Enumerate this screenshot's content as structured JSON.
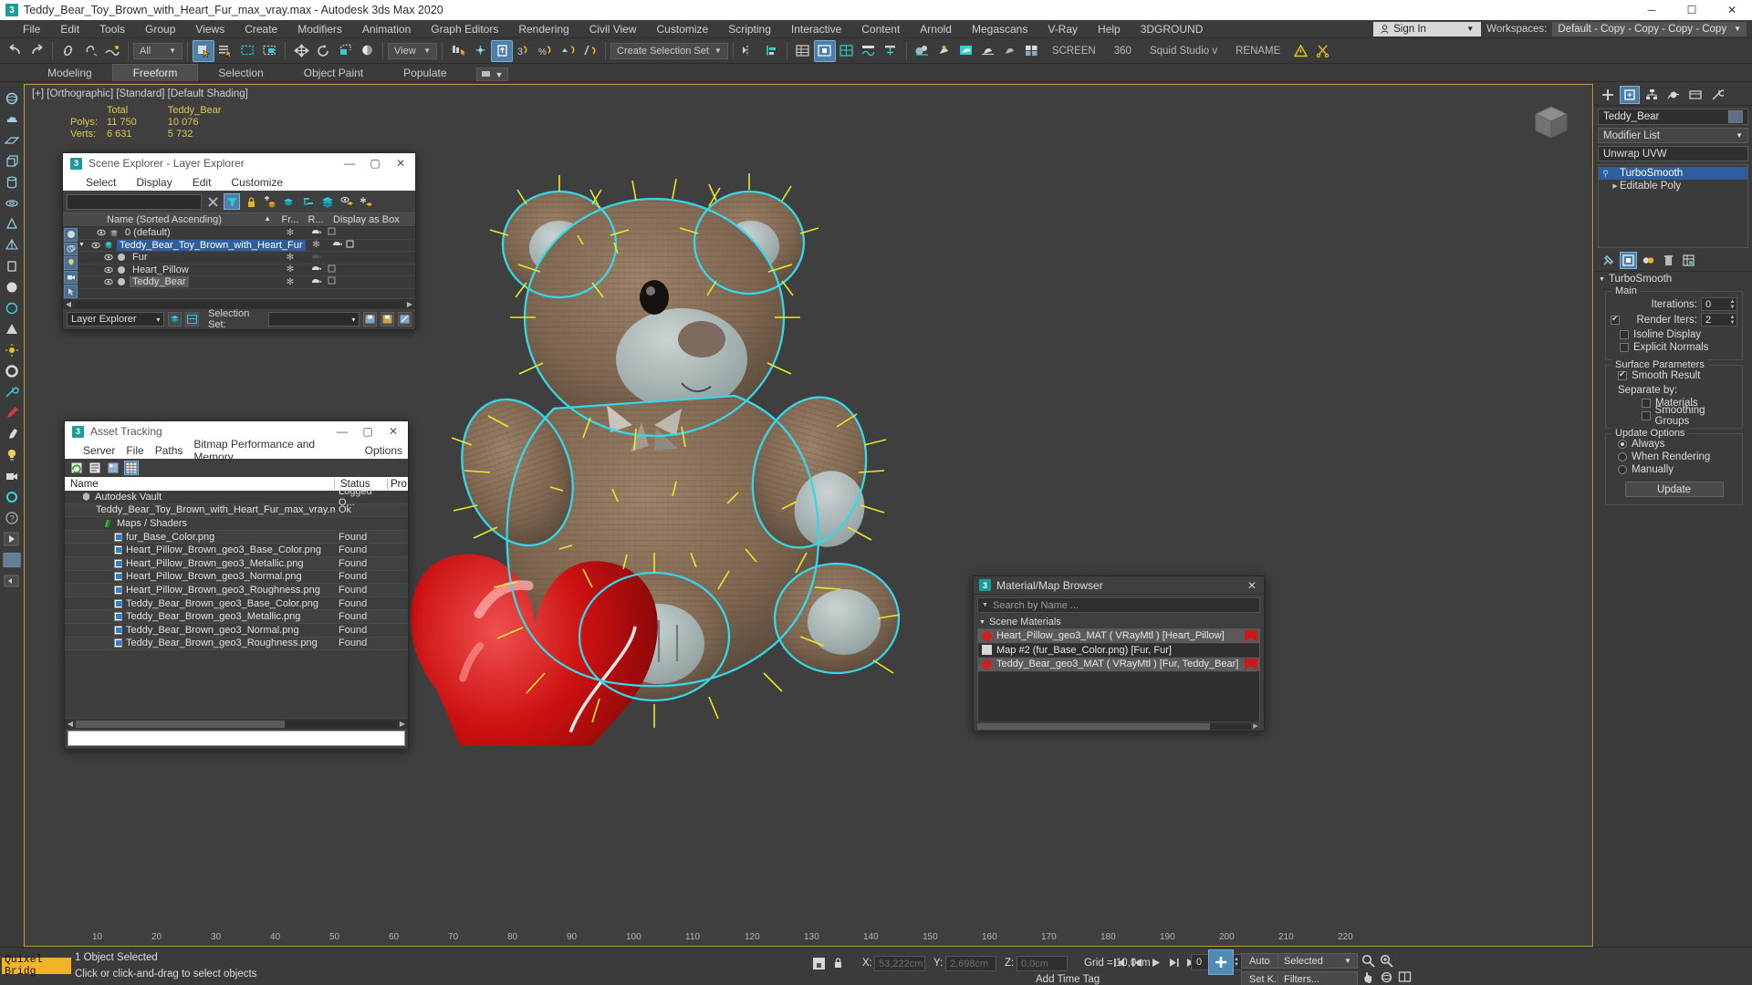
{
  "titlebar": {
    "title": "Teddy_Bear_Toy_Brown_with_Heart_Fur_max_vray.max - Autodesk 3ds Max 2020",
    "app_icon": "3dsmax-icon",
    "minimize": "─",
    "maximize": "☐",
    "close": "✕"
  },
  "menubar": {
    "items": [
      "File",
      "Edit",
      "Tools",
      "Group",
      "Views",
      "Create",
      "Modifiers",
      "Animation",
      "Graph Editors",
      "Rendering",
      "Civil View",
      "Customize",
      "Scripting",
      "Interactive",
      "Content",
      "Arnold",
      "Megascans",
      "V-Ray",
      "Help",
      "3DGROUND"
    ],
    "sign_in": "Sign In",
    "workspaces_label": "Workspaces:",
    "workspace_value": "Default - Copy - Copy - Copy - Copy"
  },
  "toolbar": {
    "filter_value": "All",
    "ref_coord_value": "View",
    "selection_set_value": "Create Selection Set",
    "screen_label": "SCREEN",
    "count_label": "360",
    "studio_label": "Squid Studio v",
    "rename_label": "RENAME"
  },
  "ribbon": {
    "tabs": [
      "Modeling",
      "Freeform",
      "Selection",
      "Object Paint",
      "Populate"
    ],
    "selected": "Freeform"
  },
  "viewport": {
    "label": "[+] [Orthographic] [Standard] [Default Shading]",
    "stats": {
      "col_total": "Total",
      "col_object": "Teddy_Bear",
      "rows": [
        {
          "name": "Polys:",
          "total": "11 750",
          "object": "10 076"
        },
        {
          "name": "Verts:",
          "total": "6 631",
          "object": "5 732"
        }
      ]
    },
    "ruler_ticks": [
      "10",
      "20",
      "30",
      "40",
      "50",
      "60",
      "70",
      "80",
      "90",
      "100",
      "110",
      "120",
      "130",
      "140",
      "150",
      "160",
      "170",
      "180",
      "190",
      "200",
      "210",
      "220"
    ]
  },
  "scene_explorer": {
    "title": "Scene Explorer - Layer Explorer",
    "menu": [
      "Select",
      "Display",
      "Edit",
      "Customize"
    ],
    "search_value": "",
    "columns": {
      "name": "Name (Sorted Ascending)",
      "fr": "Fr...",
      "r": "R...",
      "display_as_box": "Display as Box"
    },
    "rows": [
      {
        "label": "0 (default)",
        "indent": 1,
        "type": "layer",
        "selected": false,
        "expand": ""
      },
      {
        "label": "Teddy_Bear_Toy_Brown_with_Heart_Fur",
        "indent": 1,
        "type": "layer",
        "selected": true,
        "expand": "▼"
      },
      {
        "label": "Fur",
        "indent": 2,
        "type": "object",
        "selected": false,
        "expand": ""
      },
      {
        "label": "Heart_Pillow",
        "indent": 2,
        "type": "object",
        "selected": false,
        "expand": ""
      },
      {
        "label": "Teddy_Bear",
        "indent": 2,
        "type": "object",
        "selected": false,
        "expand": ""
      }
    ],
    "footer": {
      "explorer_name": "Layer Explorer",
      "selection_set_label": "Selection Set:",
      "selection_set_value": ""
    }
  },
  "asset_tracking": {
    "title": "Asset Tracking",
    "menu": [
      "Server",
      "File",
      "Paths",
      "Bitmap Performance and Memory",
      "Options"
    ],
    "columns": {
      "name": "Name",
      "status": "Status",
      "path": "Pro"
    },
    "rows": [
      {
        "name": "Autodesk Vault",
        "status": "Logged O...",
        "indent": 1,
        "icon": "vault-icon"
      },
      {
        "name": "Teddy_Bear_Toy_Brown_with_Heart_Fur_max_vray.max",
        "status": "Ok",
        "indent": 2,
        "icon": "max-file-icon"
      },
      {
        "name": "Maps / Shaders",
        "status": "",
        "indent": 3,
        "icon": "maps-icon"
      },
      {
        "name": "fur_Base_Color.png",
        "status": "Found",
        "indent": 4,
        "icon": "png-icon"
      },
      {
        "name": "Heart_Pillow_Brown_geo3_Base_Color.png",
        "status": "Found",
        "indent": 4,
        "icon": "png-icon"
      },
      {
        "name": "Heart_Pillow_Brown_geo3_Metallic.png",
        "status": "Found",
        "indent": 4,
        "icon": "png-icon"
      },
      {
        "name": "Heart_Pillow_Brown_geo3_Normal.png",
        "status": "Found",
        "indent": 4,
        "icon": "png-icon"
      },
      {
        "name": "Heart_Pillow_Brown_geo3_Roughness.png",
        "status": "Found",
        "indent": 4,
        "icon": "png-icon"
      },
      {
        "name": "Teddy_Bear_Brown_geo3_Base_Color.png",
        "status": "Found",
        "indent": 4,
        "icon": "png-icon"
      },
      {
        "name": "Teddy_Bear_Brown_geo3_Metallic.png",
        "status": "Found",
        "indent": 4,
        "icon": "png-icon"
      },
      {
        "name": "Teddy_Bear_Brown_geo3_Normal.png",
        "status": "Found",
        "indent": 4,
        "icon": "png-icon"
      },
      {
        "name": "Teddy_Bear_Brown_geo3_Roughness.png",
        "status": "Found",
        "indent": 4,
        "icon": "png-icon"
      }
    ]
  },
  "material_browser": {
    "title": "Material/Map Browser",
    "search_placeholder": "Search by Name ...",
    "section_label": "Scene Materials",
    "entries": [
      {
        "label": "Heart_Pillow_geo3_MAT  ( VRayMtl )  [Heart_Pillow]",
        "swatch": "#cf2020",
        "shape": "circle",
        "highlight": true
      },
      {
        "label": "Map #2 (fur_Base_Color.png)  [Fur, Fur]",
        "swatch": "#d8d8d8",
        "shape": "square",
        "highlight": false
      },
      {
        "label": "Teddy_Bear_geo3_MAT  ( VRayMtl )  [Fur, Teddy_Bear]",
        "swatch": "#cf2020",
        "shape": "circle",
        "highlight": true
      }
    ]
  },
  "command_panel": {
    "object_name": "Teddy_Bear",
    "modifier_list_label": "Modifier List",
    "modifier_current": "Unwrap UVW",
    "stack": [
      {
        "label": "TurboSmooth",
        "selected": true,
        "has_bulb": true,
        "expandable": false
      },
      {
        "label": "Editable Poly",
        "selected": false,
        "has_bulb": false,
        "expandable": true
      }
    ],
    "rollout": {
      "title": "TurboSmooth",
      "main_group": "Main",
      "iterations_label": "Iterations:",
      "iterations_value": "0",
      "render_iters_label": "Render Iters:",
      "render_iters_value": "2",
      "render_iters_checked": true,
      "isoline_display": "Isoline Display",
      "isoline_checked": false,
      "explicit_normals": "Explicit Normals",
      "explicit_checked": false,
      "surface_params_group": "Surface Parameters",
      "smooth_result": "Smooth Result",
      "smooth_checked": true,
      "separate_by": "Separate by:",
      "materials": "Materials",
      "materials_checked": false,
      "smoothing_groups": "Smoothing Groups",
      "smoothing_checked": false,
      "update_options_group": "Update Options",
      "always": "Always",
      "when_rendering": "When Rendering",
      "manually": "Manually",
      "update_mode": "Always",
      "update_button": "Update"
    }
  },
  "statusbar": {
    "quixel": "Quixel Bridg",
    "line1": "1 Object Selected",
    "line2": "Click or click-and-drag to select objects",
    "x_label": "X:",
    "x_value": "53,222cm",
    "y_label": "Y:",
    "y_value": "2,698cm",
    "z_label": "Z:",
    "z_value": "0,0cm",
    "grid_label": "Grid = 10,0cm",
    "add_time_tag": "Add Time Tag",
    "auto_key": "Auto",
    "set_key": "Set K.",
    "selected_filter": "Selected",
    "filters_label": "Filters...",
    "frame_value": "0"
  },
  "colors": {
    "accent_blue": "#4f7ea8",
    "selection_blue": "#2f5d9e",
    "yellow_stat": "#e0c84f",
    "viewport_border": "#b8a23c",
    "heart_red": "#cc1f1f",
    "fur_cyan": "#35d7e8",
    "fur_yellow": "#e8e82a"
  }
}
